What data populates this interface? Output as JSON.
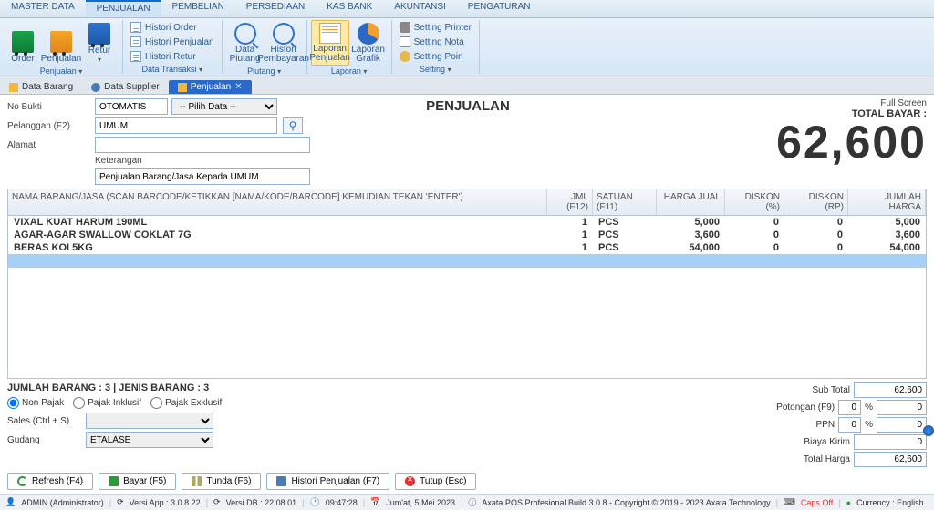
{
  "main_tabs": [
    "MASTER DATA",
    "PENJUALAN",
    "PEMBELIAN",
    "PERSEDIAAN",
    "KAS BANK",
    "AKUNTANSI",
    "PENGATURAN"
  ],
  "main_tab_active": 1,
  "ribbon": {
    "penjualan": {
      "order": "Order",
      "penjualan": "Penjualan",
      "retur": "Retur",
      "label": "Penjualan"
    },
    "transaksi": {
      "histori_order": "Histori Order",
      "histori_penjualan": "Histori Penjualan",
      "histori_retur": "Histori Retur",
      "label": "Data Transaksi"
    },
    "piutang": {
      "data": "Data Piutang",
      "histori": "Histori Pembayaran",
      "label": "Piutang"
    },
    "laporan": {
      "penjualan": "Laporan Penjualan",
      "grafik": "Laporan Grafik",
      "label": "Laporan"
    },
    "setting": {
      "printer": "Setting Printer",
      "nota": "Setting Nota",
      "poin": "Setting Poin",
      "label": "Setting"
    }
  },
  "doc_tabs": {
    "data_barang": "Data Barang",
    "data_supplier": "Data Supplier",
    "penjualan": "Penjualan"
  },
  "form": {
    "no_bukti_label": "No Bukti",
    "no_bukti_value": "OTOMATIS",
    "pilih_data": "-- Pilih Data --",
    "pelanggan_label": "Pelanggan (F2)",
    "pelanggan_value": "UMUM",
    "alamat_label": "Alamat",
    "alamat_value": "",
    "keterangan_label": "Keterangan",
    "keterangan_value": "Penjualan Barang/Jasa Kepada UMUM",
    "title": "PENJUALAN",
    "full_screen": "Full Screen",
    "total_bayar_label": "TOTAL BAYAR :",
    "total_bayar_value": "62,600"
  },
  "grid": {
    "headers": {
      "nama": "NAMA BARANG/JASA (SCAN BARCODE/KETIKKAN [NAMA/KODE/BARCODE] KEMUDIAN TEKAN 'ENTER')",
      "jml": "JML (F12)",
      "satuan": "SATUAN (F11)",
      "harga": "HARGA JUAL",
      "diskon": "DISKON (%)",
      "diskonrp": "DISKON (RP)",
      "jumlah": "JUMLAH HARGA"
    },
    "rows": [
      {
        "nama": "VIXAL KUAT HARUM 190ML",
        "jml": "1",
        "satuan": "PCS",
        "harga": "5,000",
        "diskon": "0",
        "diskonrp": "0",
        "jumlah": "5,000"
      },
      {
        "nama": "AGAR-AGAR SWALLOW COKLAT 7G",
        "jml": "1",
        "satuan": "PCS",
        "harga": "3,600",
        "diskon": "0",
        "diskonrp": "0",
        "jumlah": "3,600"
      },
      {
        "nama": "BERAS KOI 5KG",
        "jml": "1",
        "satuan": "PCS",
        "harga": "54,000",
        "diskon": "0",
        "diskonrp": "0",
        "jumlah": "54,000"
      }
    ]
  },
  "bottom": {
    "jumlah": "JUMLAH BARANG : 3 | JENIS BARANG : 3",
    "non_pajak": "Non Pajak",
    "pajak_inklusif": "Pajak Inklusif",
    "pajak_exklusif": "Pajak Exklusif",
    "sales_label": "Sales (Ctrl + S)",
    "sales_value": "",
    "gudang_label": "Gudang",
    "gudang_value": "ETALASE",
    "subtotal_label": "Sub Total",
    "subtotal": "62,600",
    "potongan_label": "Potongan (F9)",
    "potongan_pct": "0",
    "potongan_val": "0",
    "ppn_label": "PPN",
    "ppn_pct": "0",
    "ppn_val": "0",
    "biaya_label": "Biaya Kirim",
    "biaya": "0",
    "total_label": "Total Harga",
    "total": "62,600",
    "pct": "%"
  },
  "actions": {
    "refresh": "Refresh (F4)",
    "bayar": "Bayar (F5)",
    "tunda": "Tunda (F6)",
    "histori": "Histori Penjualan (F7)",
    "tutup": "Tutup (Esc)"
  },
  "status": {
    "user": "ADMIN (Administrator)",
    "versi_app": "Versi App : 3.0.8.22",
    "versi_db": "Versi DB : 22.08.01",
    "time": "09:47:28",
    "date": "Jum'at, 5 Mei 2023",
    "build": "Axata POS Profesional Build 3.0.8 - Copyright © 2019 - 2023 Axata Technology",
    "caps": "Caps Off",
    "currency": "Currency : English"
  }
}
